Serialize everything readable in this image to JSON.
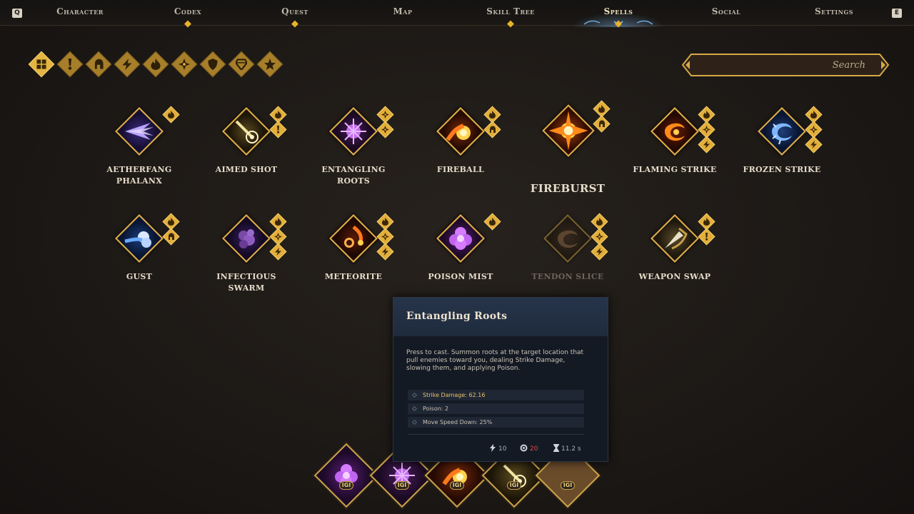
{
  "nav": {
    "left_key": "Q",
    "right_key": "E",
    "tabs": [
      {
        "label": "Character",
        "dot": false,
        "active": false
      },
      {
        "label": "Codex",
        "dot": true,
        "active": false
      },
      {
        "label": "Quest",
        "dot": true,
        "active": false
      },
      {
        "label": "Map",
        "dot": false,
        "active": false
      },
      {
        "label": "Skill Tree",
        "dot": true,
        "active": false
      },
      {
        "label": "Spells",
        "dot": true,
        "active": true
      },
      {
        "label": "Social",
        "dot": false,
        "active": false
      },
      {
        "label": "Settings",
        "dot": false,
        "active": false
      }
    ]
  },
  "filters": [
    {
      "icon": "all-grid-icon",
      "active": true
    },
    {
      "icon": "exclamation-icon",
      "active": false
    },
    {
      "icon": "helmet-icon",
      "active": false
    },
    {
      "icon": "lightning-icon",
      "active": false
    },
    {
      "icon": "flame-icon",
      "active": false
    },
    {
      "icon": "compass-icon",
      "active": false
    },
    {
      "icon": "shield-icon",
      "active": false
    },
    {
      "icon": "gem-icon",
      "active": false
    },
    {
      "icon": "star-icon",
      "active": false
    }
  ],
  "search": {
    "placeholder": "Search"
  },
  "spells": [
    {
      "name": "Aetherfang Phalanx",
      "line1": "AETHERFANG",
      "line2": "PHALANX",
      "theme": "aether",
      "tags": [
        "flame"
      ],
      "disabled": false
    },
    {
      "name": "Aimed Shot",
      "line1": "AIMED SHOT",
      "line2": "",
      "theme": "aimed",
      "tags": [
        "flame",
        "exclaim"
      ],
      "disabled": false
    },
    {
      "name": "Entangling Roots",
      "line1": "ENTANGLING",
      "line2": "ROOTS",
      "theme": "roots",
      "tags": [
        "compass",
        "compass"
      ],
      "disabled": false
    },
    {
      "name": "Fireball",
      "line1": "FIREBALL",
      "line2": "",
      "theme": "fireball",
      "tags": [
        "flame",
        "helmet"
      ],
      "disabled": false
    },
    {
      "name": "Fireburst",
      "line1": "FIREBURST",
      "line2": "",
      "theme": "fireburst",
      "tags": [
        "flame",
        "helmet"
      ],
      "disabled": false,
      "big": true
    },
    {
      "name": "Flaming Strike",
      "line1": "FLAMING STRIKE",
      "line2": "",
      "theme": "flaming",
      "tags": [
        "flame",
        "compass",
        "lightning"
      ],
      "disabled": false
    },
    {
      "name": "Frozen Strike",
      "line1": "FROZEN STRIKE",
      "line2": "",
      "theme": "frozen",
      "tags": [
        "flame",
        "compass",
        "lightning"
      ],
      "disabled": false
    },
    {
      "name": "Gust",
      "line1": "GUST",
      "line2": "",
      "theme": "gust",
      "tags": [
        "flame",
        "helmet"
      ],
      "disabled": false
    },
    {
      "name": "Infectious Swarm",
      "line1": "INFECTIOUS",
      "line2": "SWARM",
      "theme": "swarm",
      "tags": [
        "flame",
        "compass",
        "lightning"
      ],
      "disabled": false
    },
    {
      "name": "Meteorite",
      "line1": "METEORITE",
      "line2": "",
      "theme": "meteorite",
      "tags": [
        "flame",
        "compass",
        "lightning"
      ],
      "disabled": false
    },
    {
      "name": "Poison Mist",
      "line1": "POISON MIST",
      "line2": "",
      "theme": "mist",
      "tags": [
        "flame"
      ],
      "disabled": false
    },
    {
      "name": "Tendon Slice",
      "line1": "TENDON SLICE",
      "line2": "",
      "theme": "tendon",
      "tags": [
        "flame",
        "compass",
        "lightning"
      ],
      "disabled": true
    },
    {
      "name": "Weapon Swap",
      "line1": "WEAPON SWAP",
      "line2": "",
      "theme": "swap",
      "tags": [
        "flame",
        "exclaim"
      ],
      "disabled": false
    }
  ],
  "tooltip": {
    "title": "Entangling Roots",
    "description": "Press to cast. Summon roots at the target location that pull enemies toward you, dealing Strike Damage, slowing them, and applying Poison.",
    "stats": [
      {
        "text": "Strike Damage: 62.16",
        "highlight": true
      },
      {
        "text": "Poison: 2",
        "highlight": false
      },
      {
        "text": "Move Speed Down: 25%",
        "highlight": false
      }
    ],
    "energy": "10",
    "cost": "20",
    "cooldown": "11.2 s"
  },
  "hotbar": [
    {
      "theme": "mist",
      "key": "IGI"
    },
    {
      "theme": "roots",
      "key": "IGI"
    },
    {
      "theme": "fireball",
      "key": "IGI"
    },
    {
      "theme": "aimed",
      "key": "IGI"
    },
    {
      "theme": "empty",
      "key": "IGI"
    }
  ],
  "colors": {
    "gold": "#e2ae3a",
    "tooltip_header": "#26344a",
    "highlight_stat": "#e7c16a",
    "cost_red": "#e24b3c"
  }
}
